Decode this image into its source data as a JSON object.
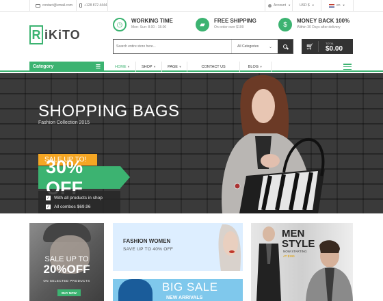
{
  "topbar": {
    "email": "contact@email.com",
    "phone": "+128 872 4444",
    "account": "Account",
    "currency": "USD $",
    "language": "en"
  },
  "header": {
    "logo_letter": "R",
    "logo_text": "iKiTO",
    "features": [
      {
        "title": "WORKING TIME",
        "subtitle": "Mon- Sun: 8.00 - 18.00",
        "icon": "clock-icon"
      },
      {
        "title": "FREE SHIPPING",
        "subtitle": "On order over $199",
        "icon": "truck-icon"
      },
      {
        "title": "MONEY BACK 100%",
        "subtitle": "Within 30 Days after delivery",
        "icon": "money-icon"
      }
    ],
    "search": {
      "placeholder": "Search entire store here...",
      "category": "All Categories"
    },
    "cart": {
      "label": "TOTAL",
      "value": "$0.00"
    }
  },
  "nav": {
    "category_label": "Category",
    "items": [
      "HOME",
      "SHOP",
      "PAGE",
      "CONTACT US",
      "BLOG"
    ]
  },
  "hero": {
    "title": "SHOPPING BAGS",
    "subtitle": "Fashion Collection 2015",
    "sale_tag": "SALE UP TO!",
    "sale_percent": "30% OFF",
    "checks": [
      "With all products in shop",
      "All combos $69.96"
    ]
  },
  "banners": {
    "b1": {
      "line1": "SALE UP TO",
      "line2": "20%OFF",
      "line3": "ON SELECTED PRODUCTS",
      "button": "BUY NOW"
    },
    "b2": {
      "title": "FASHION WOMEN",
      "subtitle": "SAVE UP TO 40% OFF"
    },
    "b3": {
      "title": "BIG SALE",
      "subtitle": "NEW ARRIVALS"
    },
    "b4": {
      "title1": "MEN",
      "title2": "STYLE",
      "subtitle": "NOW STARTING",
      "price": "AT $199"
    }
  },
  "colors": {
    "accent": "#3cb371",
    "dark": "#333333",
    "orange": "#f5a623"
  }
}
